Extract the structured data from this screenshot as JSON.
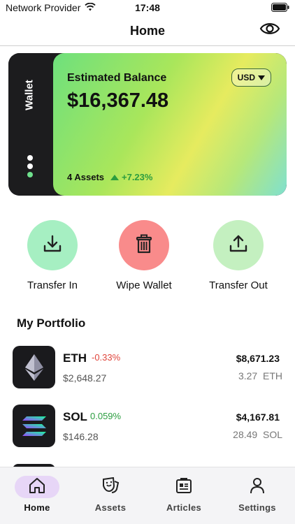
{
  "status_bar": {
    "carrier": "Network Provider",
    "time": "17:48"
  },
  "nav": {
    "title": "Home"
  },
  "wallet": {
    "side_label": "Wallet",
    "balance_label": "Estimated Balance",
    "balance": "$16,367.48",
    "currency": "USD",
    "assets_count": "4 Assets",
    "change": "+7.23%",
    "page_dots": 3,
    "active_dot": 2
  },
  "actions": [
    {
      "label": "Transfer In",
      "icon": "download-icon",
      "color": "#a6efc2"
    },
    {
      "label": "Wipe Wallet",
      "icon": "trash-icon",
      "color": "#f98b8b"
    },
    {
      "label": "Transfer Out",
      "icon": "upload-icon",
      "color": "#c4f0c0"
    }
  ],
  "portfolio": {
    "title": "My Portfolio",
    "assets": [
      {
        "symbol": "ETH",
        "change": "-0.33%",
        "change_color": "#e0453c",
        "price": "$2,648.27",
        "value": "$8,671.23",
        "holding": "3.27  ETH",
        "icon": "ethereum-icon"
      },
      {
        "symbol": "SOL",
        "change": "0.059%",
        "change_color": "#2b9d3f",
        "price": "$146.28",
        "value": "$4,167.81",
        "holding": "28.49  SOL",
        "icon": "solana-icon"
      }
    ]
  },
  "tabs": [
    {
      "label": "Home",
      "icon": "home-icon",
      "active": true
    },
    {
      "label": "Assets",
      "icon": "theater-masks-icon",
      "active": false
    },
    {
      "label": "Articles",
      "icon": "newspaper-icon",
      "active": false
    },
    {
      "label": "Settings",
      "icon": "person-icon",
      "active": false
    }
  ],
  "colors": {
    "accent_tab": "#e7d6f7",
    "positive": "#2b9d3f",
    "negative": "#e0453c"
  }
}
